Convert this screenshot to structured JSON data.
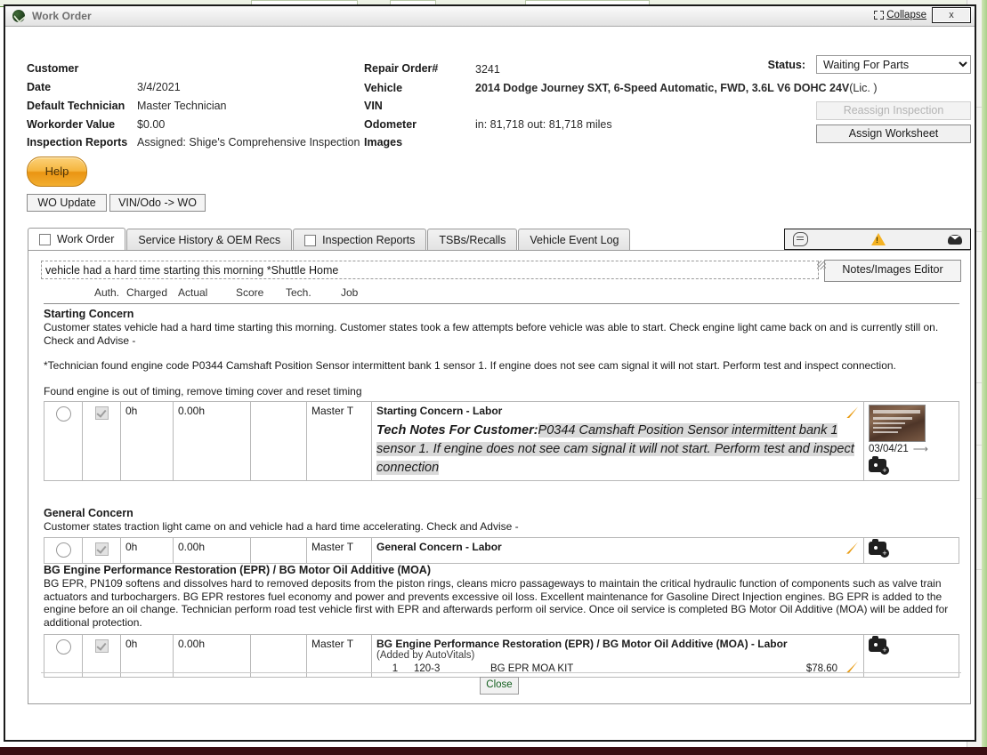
{
  "background": {
    "accent_green": "#5b8a3c",
    "page_bottom_color": "#3a0d12"
  },
  "window": {
    "title": "Work Order",
    "icon": "work-order-logo-icon",
    "collapse_label": "Collapse",
    "close_label": "x"
  },
  "header": {
    "left_fields": [
      {
        "label": "Customer",
        "value": ""
      },
      {
        "label": "Date",
        "value": "3/4/2021"
      },
      {
        "label": "Default Technician",
        "value": "Master Technician"
      },
      {
        "label": "Workorder Value",
        "value": "$0.00"
      },
      {
        "label": "Inspection Reports",
        "value": "Assigned: Shige's Comprehensive Inspection"
      }
    ],
    "right_fields": [
      {
        "label": "Repair Order#",
        "value": "3241"
      },
      {
        "label": "Vehicle",
        "value": "2014 Dodge Journey SXT, 6-Speed Automatic, FWD, 3.6L V6 DOHC 24V",
        "suffix": "(Lic.                )"
      },
      {
        "label": "VIN",
        "value": ""
      },
      {
        "label": "Odometer",
        "value": "in: 81,718 out: 81,718 miles"
      },
      {
        "label": "Images",
        "value": ""
      }
    ],
    "status_label": "Status:",
    "status_value": "Waiting For Parts",
    "status_options": [
      "Waiting For Parts"
    ],
    "reassign_inspection_label": "Reassign Inspection",
    "assign_worksheet_label": "Assign Worksheet"
  },
  "toolbar": {
    "help_label": "Help",
    "wo_update_label": "WO Update",
    "vin_odo_label": "VIN/Odo -> WO"
  },
  "tabs": [
    {
      "label": "Work Order",
      "checkbox": true,
      "active": true
    },
    {
      "label": "Service History & OEM Recs",
      "checkbox": false,
      "active": false
    },
    {
      "label": "Inspection Reports",
      "checkbox": true,
      "active": false
    },
    {
      "label": "TSBs/Recalls",
      "checkbox": false,
      "active": false
    },
    {
      "label": "Vehicle Event Log",
      "checkbox": false,
      "active": false
    }
  ],
  "notifications": {
    "chat_icon": "chat-bubble-icon",
    "warning_icon": "warning-triangle-icon",
    "mail_icon": "mail-envelope-icon"
  },
  "notes": {
    "value": "vehicle had a hard time starting this morning *Shuttle Home",
    "placeholder": "",
    "editor_button_label": "Notes/Images Editor"
  },
  "columns": {
    "auth": "Auth.",
    "charged": "Charged",
    "actual": "Actual",
    "score": "Score",
    "tech": "Tech.",
    "job": "Job"
  },
  "sections": [
    {
      "id": "starting-concern",
      "title": "Starting Concern",
      "body_lines": [
        "Customer states vehicle had a hard time starting this morning. Customer states took a few attempts before vehicle was able to start. Check engine light came back on and is currently still on. Check and Advise -",
        "",
        "*Technician found engine code P0344 Camshaft Position Sensor intermittent bank 1 sensor 1. If engine does not see cam signal it will not start. Perform test and inspect connection.",
        "",
        "Found engine is out of timing, remove timing cover and reset timing"
      ],
      "row": {
        "auth": "0h",
        "charged": "0.00h",
        "actual": "",
        "score": "",
        "tech": "Master T",
        "job_title": "Starting Concern - Labor",
        "tech_notes_label": "Tech Notes For Customer:",
        "tech_notes_text": "P0344 Camshaft Position Sensor intermittent bank 1 sensor 1. If engine does not see cam signal it will not start. Perform test and inspect connection",
        "has_image": true,
        "image_date": "03/04/21"
      }
    },
    {
      "id": "general-concern",
      "title": "General Concern",
      "body_lines": [
        "Customer states traction light came on and vehicle had a hard time accelerating. Check and Advise -"
      ],
      "row": {
        "auth": "0h",
        "charged": "0.00h",
        "actual": "",
        "score": "",
        "tech": "Master T",
        "job_title": "General Concern - Labor",
        "has_image": false
      }
    },
    {
      "id": "bg-epr-moa",
      "title": "BG Engine Performance Restoration (EPR) / BG Motor Oil Additive (MOA)",
      "body_lines": [
        "BG EPR, PN109 softens and dissolves hard to removed deposits from the piston rings, cleans micro passageways to maintain the critical hydraulic function of components such as valve train actuators and turbochargers. BG EPR restores fuel economy and power and prevents excessive oil loss. Excellent maintenance for Gasoline Direct Injection engines. BG EPR is added to the engine before an oil change. Technician perform road test vehicle first with EPR and afterwards perform oil service. Once oil service is completed BG Motor Oil Additive (MOA) will be added for additional protection."
      ],
      "row": {
        "auth": "0h",
        "charged": "0.00h",
        "actual": "",
        "score": "",
        "tech": "Master T",
        "job_title": "BG Engine Performance Restoration (EPR) / BG Motor Oil Additive (MOA) - Labor",
        "added_by": "(Added by AutoVitals)",
        "part": {
          "qty": "1",
          "number": "120-3",
          "description": "BG EPR MOA KIT",
          "price": "$78.60"
        },
        "has_image": false
      }
    }
  ],
  "footer": {
    "close_label": "Close"
  }
}
